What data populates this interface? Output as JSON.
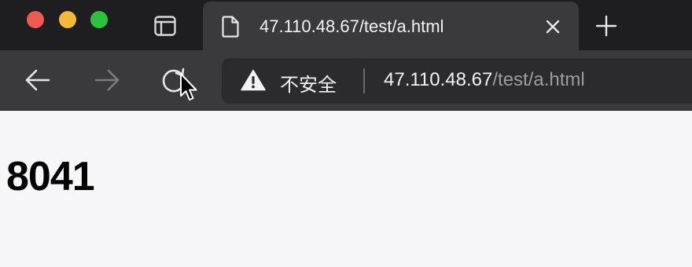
{
  "window": {
    "title": "47.110.48.67/test/a.html"
  },
  "tab": {
    "title": "47.110.48.67/test/a.html",
    "page_icon": "document-icon",
    "close_icon": "close-icon"
  },
  "tabstrip": {
    "sidebar_icon": "sidebar-icon",
    "new_tab_icon": "plus-icon"
  },
  "toolbar": {
    "back_icon": "arrow-left-icon",
    "forward_icon": "arrow-right-icon",
    "reload_icon": "reload-icon"
  },
  "address_bar": {
    "warning_icon": "warning-icon",
    "security_label": "不安全",
    "url_host": "47.110.48.67",
    "url_path": "/test/a.html"
  },
  "page": {
    "content_text": "8041"
  },
  "colors": {
    "tabstrip_bg": "#1e1e20",
    "toolbar_bg": "#3a3a3d",
    "address_bg": "#2b2b2e",
    "page_bg": "#f7f7f9",
    "traffic_close": "#ee5a52",
    "traffic_minimize": "#f5b93a",
    "traffic_maximize": "#2cc23e"
  }
}
